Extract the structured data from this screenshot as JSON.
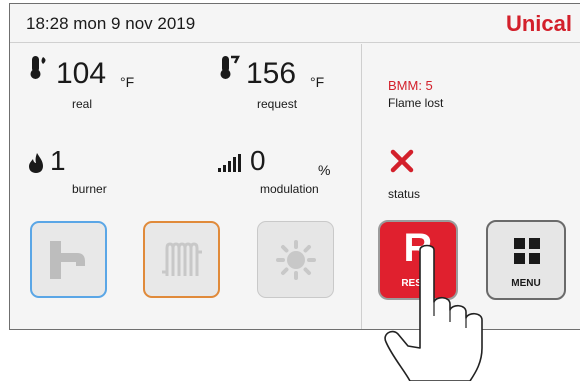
{
  "header": {
    "datetime": "18:28  mon 9 nov 2019",
    "brand": "Unical"
  },
  "readings": {
    "real": {
      "value": "104",
      "unit": "°F",
      "label": "real",
      "icon": "thermometer-icon"
    },
    "request": {
      "value": "156",
      "unit": "°F",
      "label": "request",
      "icon": "thermometer-setpoint-icon"
    },
    "burner": {
      "value": "1",
      "label": "burner",
      "icon": "flame-icon"
    },
    "modulation": {
      "value": "0",
      "unit": "%",
      "label": "modulation",
      "icon": "signal-bars-icon"
    }
  },
  "mode_tiles": [
    {
      "icon": "faucet-icon",
      "state": "active",
      "accent": "#5aa6e6"
    },
    {
      "icon": "radiator-icon",
      "state": "active",
      "accent": "#e08a3a"
    },
    {
      "icon": "sun-icon",
      "state": "disabled"
    }
  ],
  "error": {
    "code": "BMM: 5",
    "message": "Flame lost",
    "status_label": "status",
    "status_icon": "error-x-icon",
    "color": "#d3202b"
  },
  "buttons": {
    "reset": {
      "glyph": "R",
      "label": "RESET",
      "color": "#e0202e"
    },
    "menu": {
      "label": "MENU",
      "icon": "grid-icon"
    }
  }
}
